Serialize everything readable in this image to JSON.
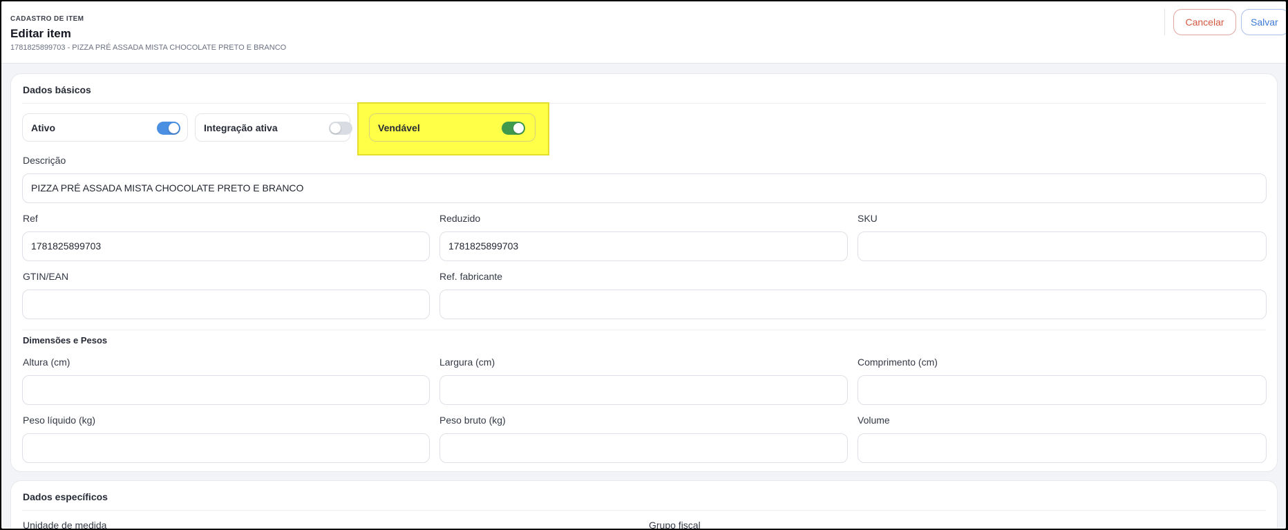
{
  "header": {
    "eyebrow": "CADASTRO DE ITEM",
    "title": "Editar item",
    "subtitle": "1781825899703 - PIZZA PRÉ ASSADA MISTA CHOCOLATE PRETO E BRANCO",
    "cancel_label": "Cancelar",
    "save_label": "Salvar"
  },
  "basic": {
    "title": "Dados básicos",
    "toggles": [
      {
        "label": "Ativo",
        "on": true,
        "color": "#4a8fe2"
      },
      {
        "label": "Integração ativa",
        "on": false,
        "color": "#d9dce2"
      },
      {
        "label": "Vendável",
        "on": true,
        "color": "#3f9a4d"
      }
    ],
    "descricao_label": "Descrição",
    "descricao_value": "PIZZA PRÉ ASSADA MISTA CHOCOLATE PRETO E BRANCO",
    "ref_label": "Ref",
    "ref_value": "1781825899703",
    "reduzido_label": "Reduzido",
    "reduzido_value": "1781825899703",
    "sku_label": "SKU",
    "sku_value": "",
    "gtin_label": "GTIN/EAN",
    "gtin_value": "",
    "ref_fab_label": "Ref. fabricante",
    "ref_fab_value": ""
  },
  "dimensions": {
    "title": "Dimensões e Pesos",
    "altura_label": "Altura (cm)",
    "largura_label": "Largura (cm)",
    "comprimento_label": "Comprimento (cm)",
    "peso_liquido_label": "Peso líquido (kg)",
    "peso_bruto_label": "Peso bruto (kg)",
    "volume_label": "Volume"
  },
  "specific": {
    "title": "Dados específicos",
    "unidade_label": "Unidade de medida",
    "grupo_fiscal_label": "Grupo fiscal"
  },
  "colors": {
    "highlight": "#ffff00",
    "cancel": "#d4583f",
    "save": "#3c7ad8"
  }
}
